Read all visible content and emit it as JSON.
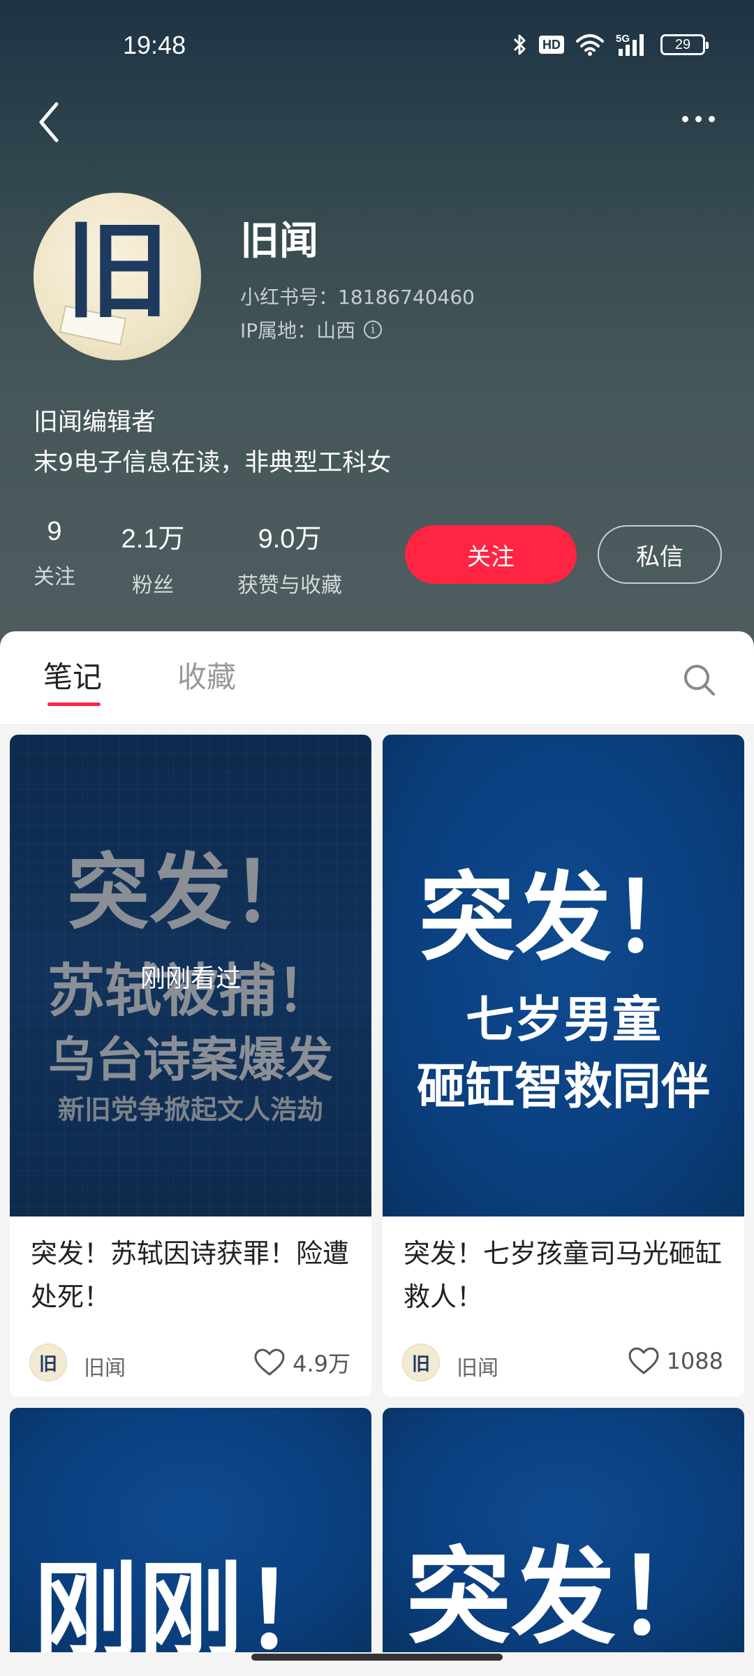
{
  "status_bar": {
    "time": "19:48",
    "hd": "HD",
    "network": "5G",
    "battery": "29"
  },
  "profile": {
    "name": "旧闻",
    "avatar_glyph": "旧",
    "id_text": "小红书号：18186740460",
    "ip_text": "IP属地：山西",
    "bio_line1": "旧闻编辑者",
    "bio_line2": "末9电子信息在读，非典型工科女"
  },
  "stats": [
    {
      "value": "9",
      "label": "关注"
    },
    {
      "value": "2.1万",
      "label": "粉丝"
    },
    {
      "value": "9.0万",
      "label": "获赞与收藏"
    }
  ],
  "actions": {
    "follow": "关注",
    "message": "私信"
  },
  "tabs": [
    {
      "label": "笔记",
      "active": true
    },
    {
      "label": "收藏",
      "active": false
    }
  ],
  "notes": [
    {
      "cover_line1": "突发！",
      "cover_line2": "苏轼被捕！",
      "cover_line3": "乌台诗案爆发",
      "cover_line4": "新旧党争掀起文人浩劫",
      "overlay": "刚刚看过",
      "title": "突发！苏轼因诗获罪！险遭处死！",
      "author": "旧闻",
      "likes": "4.9万"
    },
    {
      "cover_line1": "突发！",
      "cover_line2": "七岁男童",
      "cover_line3": "砸缸智救同伴",
      "title": "突发！七岁孩童司马光砸缸救人！",
      "author": "旧闻",
      "likes": "1088"
    },
    {
      "cover_line1": "刚刚！"
    },
    {
      "cover_line1": "突发！"
    }
  ],
  "colors": {
    "accent": "#ff2442",
    "cover_blue": "#0a3f7f"
  }
}
